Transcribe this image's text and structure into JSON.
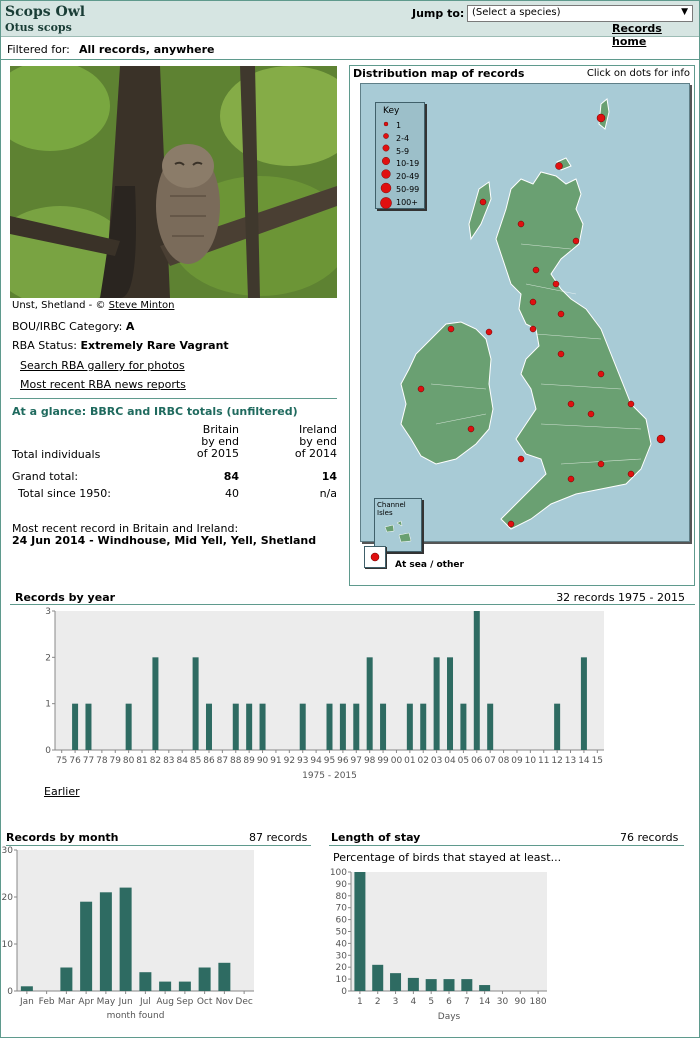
{
  "header": {
    "common_name": "Scops Owl",
    "latin_name": "Otus scops",
    "jump_label": "Jump to:",
    "select_value": "(Select a species)",
    "records_home": "Records home"
  },
  "filter": {
    "label": "Filtered for:",
    "value": "All records, anywhere"
  },
  "photo": {
    "caption_place": "Unst, Shetland - ©",
    "credit": "Steve Minton"
  },
  "status": {
    "bou_label": "BOU/IRBC Category:",
    "bou_value": "A",
    "rba_label": "RBA Status:",
    "rba_value": "Extremely Rare Vagrant"
  },
  "links": {
    "gallery": "Search RBA gallery for photos",
    "news": "Most recent RBA news reports"
  },
  "glance": {
    "title": "At a glance: BBRC and IRBC totals (unfiltered)",
    "britain_head": [
      "Britain",
      "by end",
      "of 2015"
    ],
    "ireland_head": [
      "Ireland",
      "by end",
      "of 2014"
    ],
    "total_individuals": "Total individuals",
    "grand_label": "Grand total:",
    "grand_britain": "84",
    "grand_ireland": "14",
    "since_label": "Total since 1950:",
    "since_britain": "40",
    "since_ireland": "n/a",
    "recent_label": "Most recent record in Britain and Ireland:",
    "recent_value": "24 Jun 2014  - Windhouse, Mid Yell, Yell, Shetland"
  },
  "map": {
    "title": "Distribution map of records",
    "hint": "Click on dots for info",
    "key_title": "Key",
    "key_items": [
      "1",
      "2-4",
      "5-9",
      "10-19",
      "20-49",
      "50-99",
      "100+"
    ],
    "channel_label": "Channel Isles",
    "sea_label": "At sea / other",
    "colors": {
      "sea": "#a8cbd6",
      "land": "#6aa072",
      "dot": "#e01010"
    }
  },
  "records_by_year": {
    "title": "Records by year",
    "summary": "32 records 1975 - 2015",
    "earlier_link": "Earlier"
  },
  "records_by_month": {
    "title": "Records by month",
    "count": "87 records"
  },
  "length_of_stay": {
    "title": "Length of stay",
    "count": "76 records",
    "subtitle": "Percentage of birds that stayed at least..."
  },
  "chart_data": [
    {
      "type": "bar",
      "name": "Records by year",
      "xlabel": "1975 - 2015",
      "ylabel": "",
      "ylim": [
        0,
        3
      ],
      "yticks": [
        0,
        1,
        2,
        3
      ],
      "categories": [
        "75",
        "76",
        "77",
        "78",
        "79",
        "80",
        "81",
        "82",
        "83",
        "84",
        "85",
        "86",
        "87",
        "88",
        "89",
        "90",
        "91",
        "92",
        "93",
        "94",
        "95",
        "96",
        "97",
        "98",
        "99",
        "00",
        "01",
        "02",
        "03",
        "04",
        "05",
        "06",
        "07",
        "08",
        "09",
        "10",
        "11",
        "12",
        "13",
        "14",
        "15"
      ],
      "values": [
        0,
        1,
        1,
        0,
        0,
        1,
        0,
        2,
        0,
        0,
        2,
        1,
        0,
        1,
        1,
        1,
        0,
        0,
        1,
        0,
        1,
        1,
        1,
        2,
        1,
        0,
        1,
        1,
        2,
        2,
        1,
        3,
        1,
        0,
        0,
        0,
        0,
        1,
        0,
        2,
        0
      ],
      "color": "#2e6b62"
    },
    {
      "type": "bar",
      "name": "Records by month",
      "xlabel": "month found",
      "ylabel": "",
      "ylim": [
        0,
        30
      ],
      "yticks": [
        0,
        10,
        20,
        30
      ],
      "categories": [
        "Jan",
        "Feb",
        "Mar",
        "Apr",
        "May",
        "Jun",
        "Jul",
        "Aug",
        "Sep",
        "Oct",
        "Nov",
        "Dec"
      ],
      "values": [
        1,
        0,
        5,
        19,
        21,
        22,
        4,
        2,
        2,
        5,
        6,
        0
      ],
      "color": "#2e6b62"
    },
    {
      "type": "bar",
      "name": "Length of stay",
      "xlabel": "Days",
      "ylabel": "",
      "ylim": [
        0,
        100
      ],
      "yticks": [
        0,
        10,
        20,
        30,
        40,
        50,
        60,
        70,
        80,
        90,
        100
      ],
      "categories": [
        "1",
        "2",
        "3",
        "4",
        "5",
        "6",
        "7",
        "14",
        "30",
        "90",
        "180"
      ],
      "values": [
        100,
        22,
        15,
        11,
        10,
        10,
        10,
        5,
        0,
        0,
        0
      ],
      "color": "#2e6b62"
    }
  ]
}
